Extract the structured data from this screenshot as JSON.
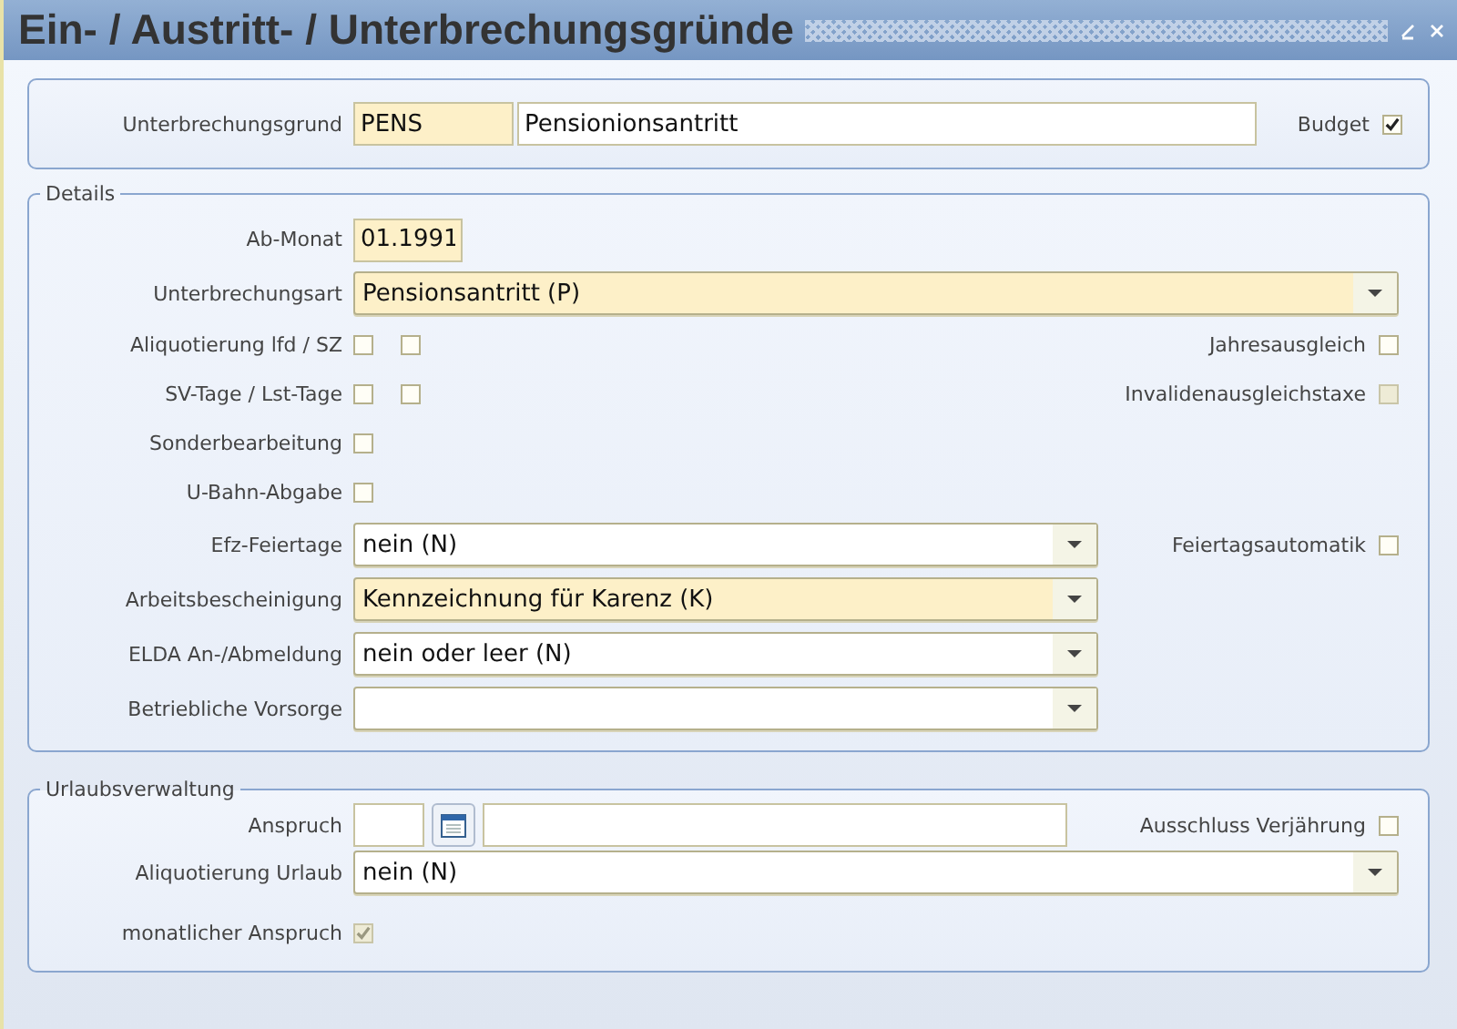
{
  "window": {
    "title": "Ein- / Austritt- / Unterbrechungsgründe"
  },
  "header": {
    "label": "Unterbrechungsgrund",
    "code": {
      "value": "PENS",
      "required": true
    },
    "text": {
      "value": "Pensionionsantritt",
      "required": false
    },
    "budget": {
      "label": "Budget",
      "checked": true,
      "disabled": false
    }
  },
  "details": {
    "legend": "Details",
    "rows": [
      {
        "kind": "text",
        "label": "Ab-Monat",
        "value": "01.1991",
        "required": true
      },
      {
        "kind": "select",
        "label": "Unterbrechungsart",
        "value": "Pensionsantritt (P)",
        "required": true,
        "wide": true
      },
      {
        "kind": "checks",
        "label": "Aliquotierung lfd / SZ",
        "checks": [
          {
            "checked": false,
            "disabled": false
          },
          {
            "checked": false,
            "disabled": false
          }
        ],
        "right": {
          "label": "Jahresausgleich",
          "checked": false,
          "disabled": false
        }
      },
      {
        "kind": "checks",
        "label": "SV-Tage / Lst-Tage",
        "checks": [
          {
            "checked": false,
            "disabled": false
          },
          {
            "checked": false,
            "disabled": false
          }
        ],
        "right": {
          "label": "Invalidenausgleichstaxe",
          "checked": false,
          "disabled": true
        }
      },
      {
        "kind": "checks",
        "label": "Sonderbearbeitung",
        "checks": [
          {
            "checked": false,
            "disabled": false
          }
        ]
      },
      {
        "kind": "checks",
        "label": "U-Bahn-Abgabe",
        "checks": [
          {
            "checked": false,
            "disabled": false
          }
        ]
      },
      {
        "kind": "select",
        "label": "Efz-Feiertage",
        "value": "nein (N)",
        "required": false,
        "wide": false,
        "right": {
          "label": "Feiertagsautomatik",
          "checked": false,
          "disabled": false
        }
      },
      {
        "kind": "select",
        "label": "Arbeitsbescheinigung",
        "value": "Kennzeichnung für Karenz (K)",
        "required": true,
        "wide": false
      },
      {
        "kind": "select",
        "label": "ELDA An-/Abmeldung",
        "value": "nein oder leer (N)",
        "required": false,
        "wide": false
      },
      {
        "kind": "select",
        "label": "Betriebliche Vorsorge",
        "required": false,
        "wide": false
      }
    ]
  },
  "urlaub": {
    "legend": "Urlaubsverwaltung",
    "rows": [
      {
        "kind": "anspruch",
        "label": "Anspruch",
        "right": {
          "label": "Ausschluss Verjährung",
          "checked": false,
          "disabled": false
        }
      },
      {
        "kind": "select",
        "label": "Aliquotierung Urlaub",
        "value": "nein (N)",
        "required": false,
        "wide": true
      },
      {
        "kind": "checks",
        "label": "monatlicher Anspruch",
        "checks": [
          {
            "checked": true,
            "disabled": true
          }
        ]
      }
    ]
  }
}
